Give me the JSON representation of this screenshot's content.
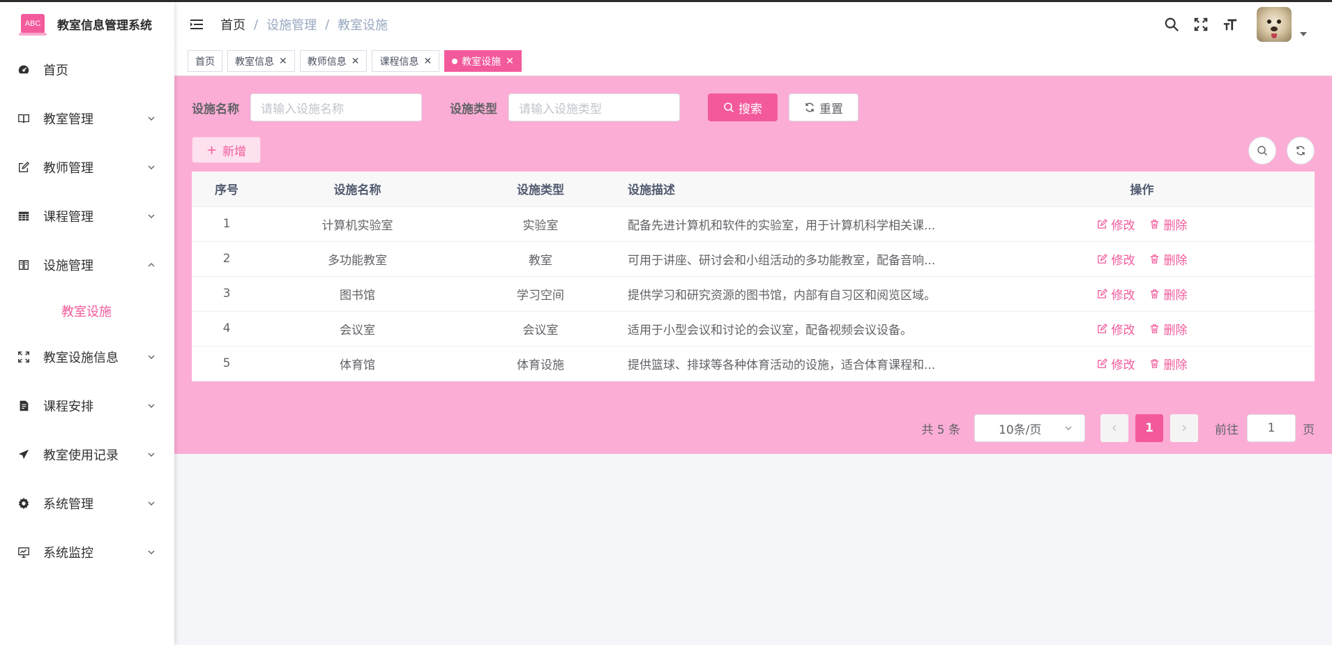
{
  "app": {
    "logo_text": "ABC",
    "title": "教室信息管理系统"
  },
  "sidebar": {
    "items": [
      {
        "label": "首页",
        "icon": "dashboard-icon"
      },
      {
        "label": "教室管理",
        "icon": "book-icon"
      },
      {
        "label": "教师管理",
        "icon": "edit-icon"
      },
      {
        "label": "课程管理",
        "icon": "table-icon"
      },
      {
        "label": "设施管理",
        "icon": "building-icon",
        "expanded": true,
        "children": [
          {
            "label": "教室设施",
            "active": true
          }
        ]
      },
      {
        "label": "教室设施信息",
        "icon": "fullscreen-icon"
      },
      {
        "label": "课程安排",
        "icon": "document-icon"
      },
      {
        "label": "教室使用记录",
        "icon": "send-icon"
      },
      {
        "label": "系统管理",
        "icon": "gear-icon"
      },
      {
        "label": "系统监控",
        "icon": "monitor-icon"
      }
    ]
  },
  "breadcrumb": {
    "home": "首页",
    "level1": "设施管理",
    "level2": "教室设施",
    "sep": "/"
  },
  "tags": [
    {
      "label": "首页",
      "closable": false
    },
    {
      "label": "教室信息",
      "closable": true
    },
    {
      "label": "教师信息",
      "closable": true
    },
    {
      "label": "课程信息",
      "closable": true
    },
    {
      "label": "教室设施",
      "closable": true,
      "active": true
    }
  ],
  "search": {
    "name_label": "设施名称",
    "name_placeholder": "请输入设施名称",
    "type_label": "设施类型",
    "type_placeholder": "请输入设施类型",
    "search_btn": "搜索",
    "reset_btn": "重置"
  },
  "toolbar": {
    "add_btn": "新增"
  },
  "table": {
    "headers": [
      "序号",
      "设施名称",
      "设施类型",
      "设施描述",
      "操作"
    ],
    "rows": [
      {
        "no": "1",
        "name": "计算机实验室",
        "type": "实验室",
        "desc": "配备先进计算机和软件的实验室，用于计算机科学相关课..."
      },
      {
        "no": "2",
        "name": "多功能教室",
        "type": "教室",
        "desc": "可用于讲座、研讨会和小组活动的多功能教室，配备音响..."
      },
      {
        "no": "3",
        "name": "图书馆",
        "type": "学习空间",
        "desc": "提供学习和研究资源的图书馆，内部有自习区和阅览区域。"
      },
      {
        "no": "4",
        "name": "会议室",
        "type": "会议室",
        "desc": "适用于小型会议和讨论的会议室，配备视频会议设备。"
      },
      {
        "no": "5",
        "name": "体育馆",
        "type": "体育设施",
        "desc": "提供篮球、排球等各种体育活动的设施，适合体育课程和..."
      }
    ],
    "edit_label": "修改",
    "delete_label": "删除"
  },
  "pagination": {
    "total_text": "共 5 条",
    "page_size": "10条/页",
    "current_page": "1",
    "goto_prefix": "前往",
    "goto_value": "1",
    "goto_suffix": "页"
  },
  "colors": {
    "accent": "#f35a9c",
    "panel_bg": "#fcadd5"
  }
}
